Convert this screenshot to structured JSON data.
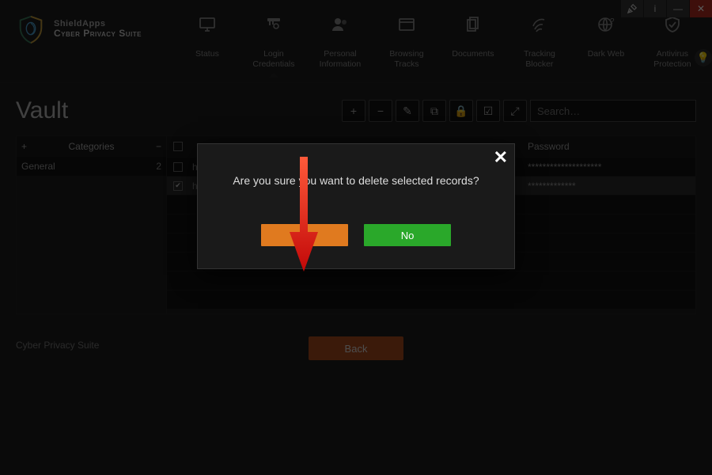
{
  "titlebar": {
    "tools_icon": "✕",
    "info_icon": "i",
    "min_icon": "—",
    "close_icon": "✕"
  },
  "brand": {
    "company": "ShieldApps",
    "product": "Cyber Privacy Suite"
  },
  "nav": {
    "status": "Status",
    "login": "Login\nCredentials",
    "personal": "Personal\nInformation",
    "browsing": "Browsing\nTracks",
    "documents": "Documents",
    "tracking": "Tracking\nBlocker",
    "darkweb": "Dark Web",
    "antivirus": "Antivirus\nProtection"
  },
  "page": {
    "title": "Vault"
  },
  "tools": {
    "add": "+",
    "remove": "−",
    "edit": "✎",
    "copy": "⧉",
    "lock": "🔒",
    "check": "☑",
    "open": "⤢"
  },
  "search": {
    "placeholder": "Search…"
  },
  "categories": {
    "header": "Categories",
    "add": "+",
    "remove": "−",
    "rows": [
      {
        "name": "General",
        "count": "2"
      }
    ]
  },
  "grid": {
    "url_header": "",
    "pwd_header": "Password",
    "rows": [
      {
        "checked": false,
        "url": "h",
        "pwd": "********************"
      },
      {
        "checked": true,
        "url": "h",
        "pwd": "*************"
      }
    ]
  },
  "back": {
    "label": "Back"
  },
  "footer": {
    "text": "Cyber Privacy Suite"
  },
  "modal": {
    "message": "Are you sure you want to delete selected records?",
    "yes": "Yes",
    "no": "No"
  },
  "hint": {
    "bulb": "💡"
  }
}
